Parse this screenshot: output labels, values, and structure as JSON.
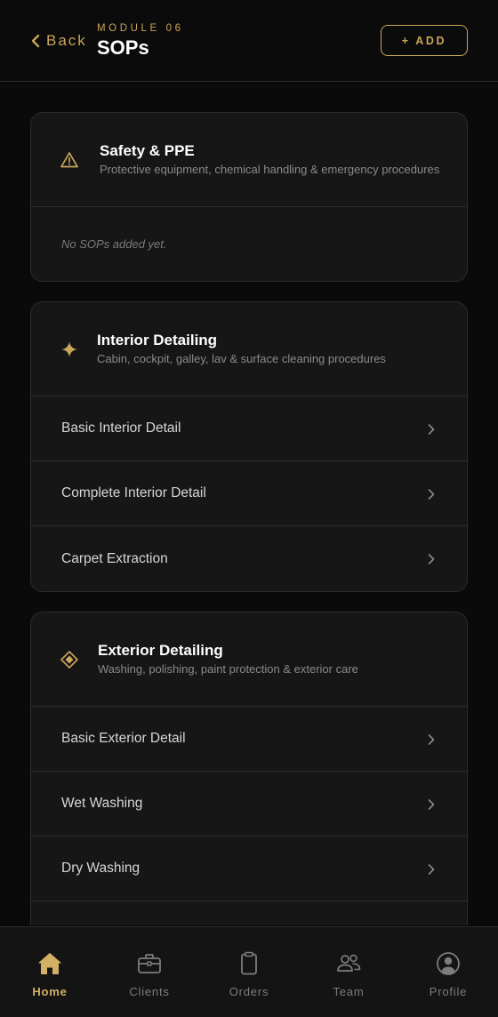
{
  "header": {
    "back_label": "Back",
    "eyebrow": "MODULE 06",
    "title": "SOPs",
    "add_label": "+ ADD"
  },
  "categories": [
    {
      "title": "Safety & PPE",
      "subtitle": "Protective equipment, chemical handling & emergency procedures",
      "icon": "warning-triangle-icon",
      "empty_text": "No SOPs added yet.",
      "items": []
    },
    {
      "title": "Interior Detailing",
      "subtitle": "Cabin, cockpit, galley, lav & surface cleaning procedures",
      "icon": "sparkle-icon",
      "items": [
        {
          "label": "Basic Interior Detail"
        },
        {
          "label": "Complete Interior Detail"
        },
        {
          "label": "Carpet Extraction"
        }
      ]
    },
    {
      "title": "Exterior Detailing",
      "subtitle": "Washing, polishing, paint protection & exterior care",
      "icon": "diamond-icon",
      "items": [
        {
          "label": "Basic Exterior Detail"
        },
        {
          "label": "Wet Washing"
        },
        {
          "label": "Dry Washing"
        }
      ]
    }
  ],
  "tabs": [
    {
      "label": "Home",
      "icon": "home-icon",
      "active": true
    },
    {
      "label": "Clients",
      "icon": "briefcase-icon",
      "active": false
    },
    {
      "label": "Orders",
      "icon": "clipboard-icon",
      "active": false
    },
    {
      "label": "Team",
      "icon": "team-icon",
      "active": false
    },
    {
      "label": "Profile",
      "icon": "profile-icon",
      "active": false
    }
  ],
  "colors": {
    "accent": "#c9a659",
    "background": "#0a0a0a",
    "card": "#161616",
    "border": "#2c2c2c",
    "muted_text": "#8a8a8a"
  }
}
